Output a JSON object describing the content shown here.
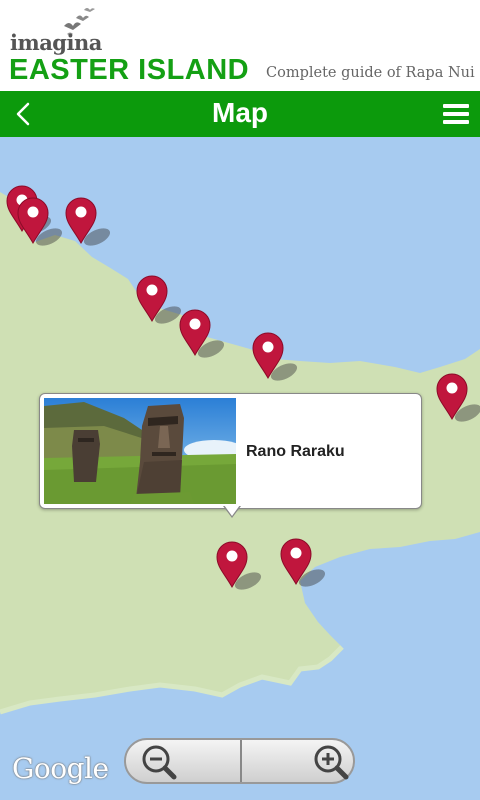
{
  "header": {
    "logo_small": "imagina",
    "logo_large": "EASTER ISLAND",
    "tagline": "Complete guide of Rapa Nui"
  },
  "titlebar": {
    "title": "Map",
    "back_icon": "chevron-left-icon",
    "menu_icon": "hamburger-menu-icon"
  },
  "map": {
    "info_window": {
      "place_name": "Rano Raraku",
      "image_alt": "moai statues at Rano Raraku"
    },
    "attribution": "Google",
    "zoom_out_icon": "zoom-out-icon",
    "zoom_in_icon": "zoom-in-icon"
  },
  "colors": {
    "brand_green": "#0c9a0c",
    "pin_red": "#c0163d",
    "land": "#cfe0b4",
    "water": "#a7cbf0"
  }
}
